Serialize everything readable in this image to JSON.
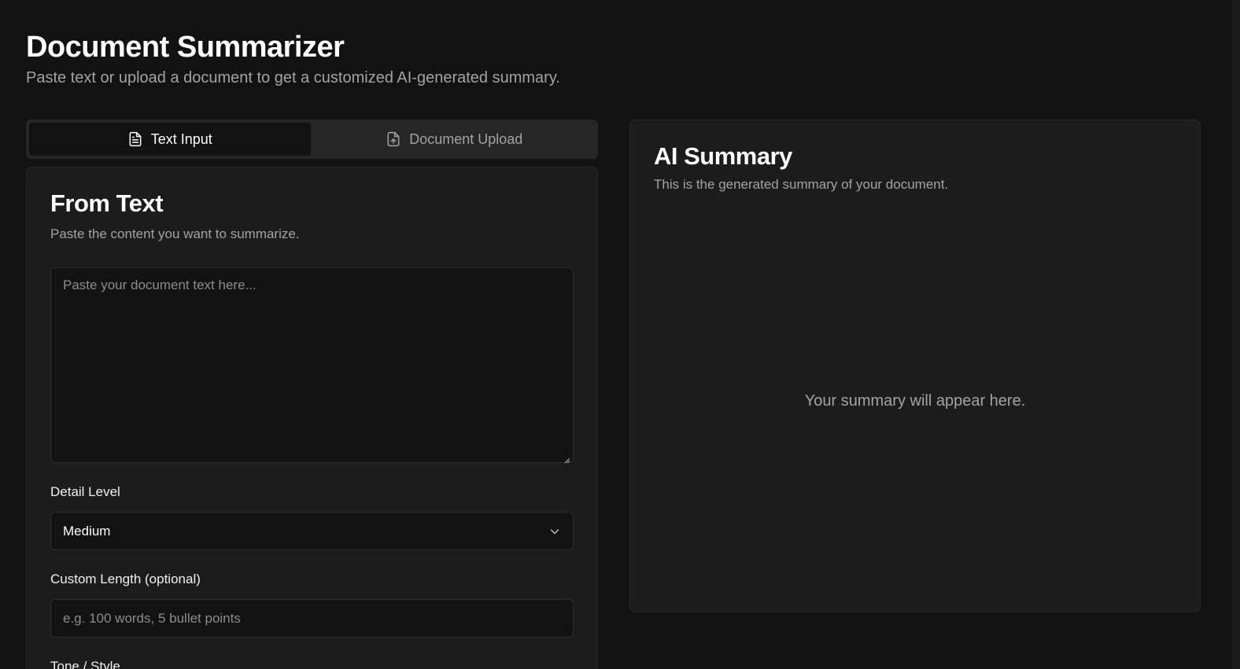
{
  "header": {
    "title": "Document Summarizer",
    "subtitle": "Paste text or upload a document to get a customized AI-generated summary."
  },
  "tabs": [
    {
      "label": "Text Input",
      "icon": "file-text-icon",
      "active": true
    },
    {
      "label": "Document Upload",
      "icon": "file-upload-icon",
      "active": false
    }
  ],
  "form": {
    "title": "From Text",
    "description": "Paste the content you want to summarize.",
    "textarea_placeholder": "Paste your document text here...",
    "detail_level": {
      "label": "Detail Level",
      "value": "Medium"
    },
    "custom_length": {
      "label": "Custom Length (optional)",
      "placeholder": "e.g. 100 words, 5 bullet points"
    },
    "tone_style": {
      "label": "Tone / Style"
    }
  },
  "summary": {
    "title": "AI Summary",
    "description": "This is the generated summary of your document.",
    "placeholder": "Your summary will appear here."
  },
  "colors": {
    "background": "#121212",
    "card": "#1c1c1c",
    "tab_bar": "#262626",
    "muted_text": "#a3a3a3"
  }
}
